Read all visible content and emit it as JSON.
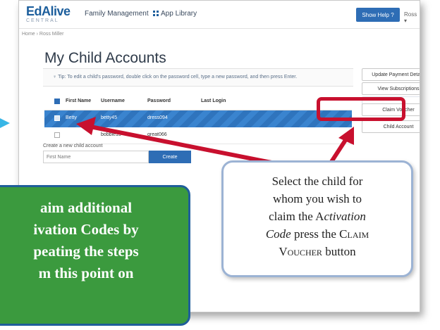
{
  "app": {
    "logo_main": "EdAlive",
    "logo_sub": "CENTRAL",
    "nav_family": "Family Management",
    "nav_app_library": "App Library",
    "help_button": "Show Help ?",
    "user_menu": "Ross ▾"
  },
  "breadcrumb": "Home › Ross Miller",
  "page_title": "My Child Accounts",
  "tip": "♀ Tip: To edit a child's password, double click on the password cell, type a new password, and then press Enter.",
  "table": {
    "columns": [
      "First Name",
      "Username",
      "Password",
      "Last Login"
    ],
    "rows": [
      {
        "first_name": "Betty",
        "username": "betty45",
        "password": "dress094",
        "last_login": "",
        "selected": true
      },
      {
        "first_name": "",
        "username": "bobbie13",
        "password": "great066",
        "last_login": "",
        "selected": false
      }
    ]
  },
  "create": {
    "label": "Create a new child account",
    "placeholder": "First Name",
    "button": "Create"
  },
  "side_buttons": {
    "update_payment": "Update Payment Details",
    "view_subscriptions": "View Subscriptions",
    "claim_voucher": "Claim Voucher",
    "delete_child": "Child Account"
  },
  "callout_right": {
    "line1": "Select the child for",
    "line2": "whom you wish to",
    "line3_prefix": "claim the A",
    "line3_italic": "ctivation",
    "line4_italic": "Code",
    "line4_suffix": " press the ",
    "line4_caps": "Claim",
    "line5_caps": "Voucher",
    "line5_suffix": " button"
  },
  "callout_left": {
    "line1": "aim additional",
    "line2": "ivation Codes by",
    "line3": "peating the steps",
    "line4": "m this point on"
  },
  "colors": {
    "brand_blue": "#2e6db5",
    "highlight_red": "#c8102e",
    "callout_green": "#3b9a3e",
    "callout_border_blue": "#9cb3d4"
  }
}
